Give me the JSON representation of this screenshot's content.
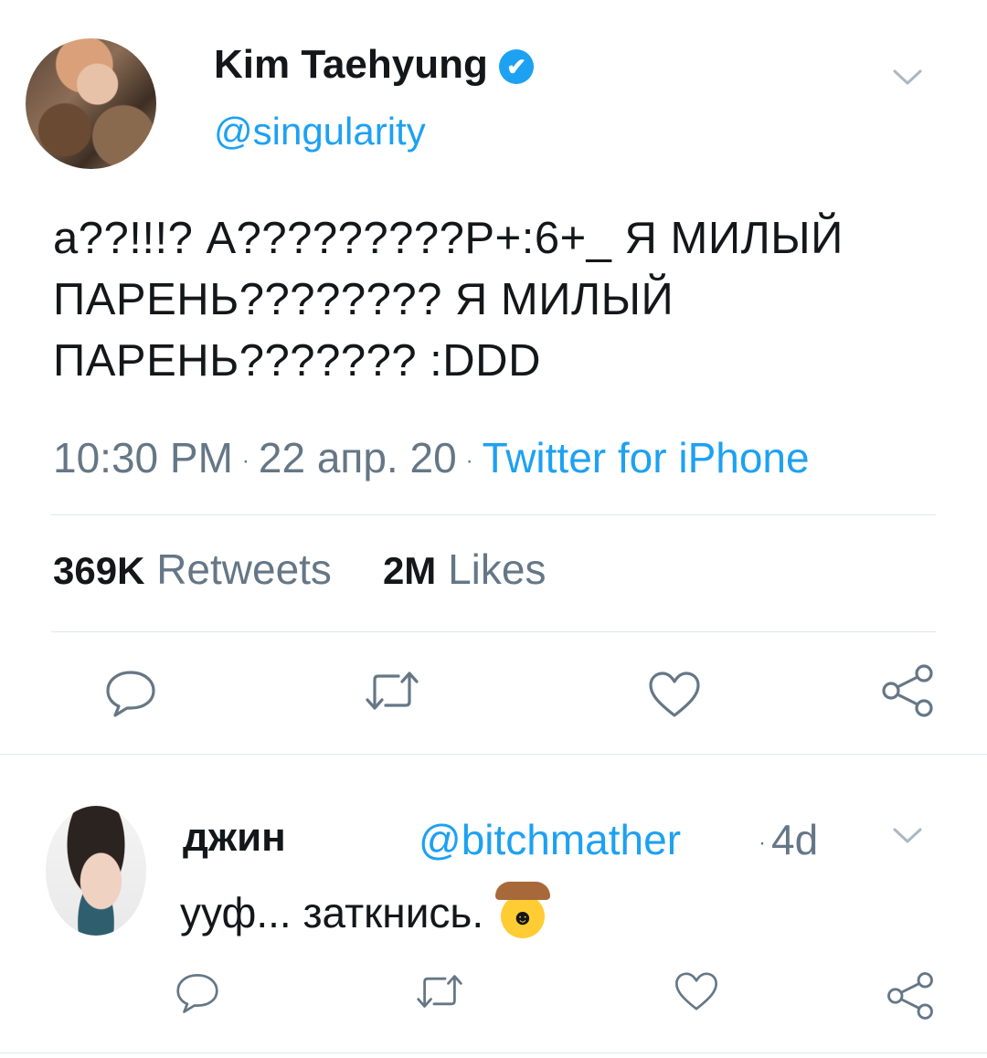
{
  "tweet": {
    "author_name": "Kim Taehyung",
    "author_handle": "@singularity",
    "verified_mark": "✔",
    "text": "а??!!!? А?????????Р+:6+_ Я МИЛЫЙ ПАРЕНЬ???????? Я МИЛЫЙ ПАРЕНЬ??????? :DDD",
    "time": "10:30 PM",
    "date": "22 апр. 20",
    "separator": "·",
    "source": "Twitter for iPhone",
    "retweets_count": "369K",
    "retweets_label": "Retweets",
    "likes_count": "2M",
    "likes_label": "Likes"
  },
  "reply": {
    "author_name": "джин",
    "author_handle": "@bitchmather",
    "separator": "·",
    "age": "4d",
    "text": "ууф... заткнись.",
    "emoji": "cowboy-hat-face-emoji"
  },
  "colors": {
    "accent": "#1da1f2",
    "secondary_text": "#657786",
    "primary_text": "#14171a",
    "divider": "#e1e8ed"
  },
  "icons": [
    "chevron-down-icon",
    "reply-icon",
    "retweet-icon",
    "like-icon",
    "share-icon"
  ]
}
